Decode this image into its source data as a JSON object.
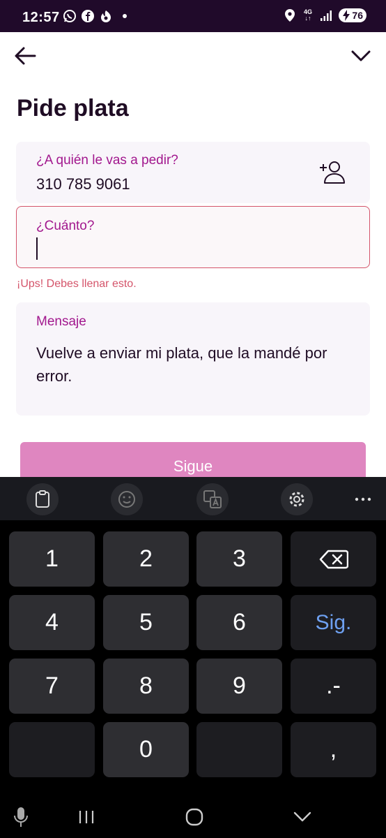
{
  "status_bar": {
    "time": "12:57",
    "network_type": "4G",
    "battery_level": "76",
    "left_icons": [
      "whatsapp-icon",
      "facebook-icon",
      "notification-app-icon"
    ],
    "right_icons": [
      "location-icon",
      "network-icon",
      "signal-icon",
      "battery-icon"
    ]
  },
  "header": {
    "back_icon": "arrow-left-icon",
    "collapse_icon": "chevron-down-icon",
    "title": "Pide plata"
  },
  "form": {
    "recipient": {
      "label": "¿A quién le vas a pedir?",
      "value": "310 785 9061",
      "action_icon": "add-contact-icon"
    },
    "amount": {
      "label": "¿Cuánto?",
      "value": "",
      "error": "¡Ups! Debes llenar esto."
    },
    "message": {
      "label": "Mensaje",
      "value": "Vuelve a enviar mi plata, que la mandé por error."
    },
    "submit_label": "Sigue"
  },
  "keyboard": {
    "toolbar": [
      "clipboard-icon",
      "emoji-icon",
      "translate-icon",
      "settings-icon",
      "more-icon"
    ],
    "keys": [
      [
        "1",
        "2",
        "3",
        "⌫"
      ],
      [
        "4",
        "5",
        "6",
        "Sig."
      ],
      [
        "7",
        "8",
        "9",
        ".-"
      ],
      [
        "",
        "0",
        "",
        ","
      ]
    ]
  },
  "navigation": {
    "buttons": [
      "mic-icon",
      "recents-icon",
      "home-icon",
      "back-icon"
    ]
  },
  "colors": {
    "status_bar": "#200a2a",
    "accent_label": "#a2188e",
    "error": "#d4546a",
    "button": "#df86c0",
    "keyboard_accent": "#6ea0f0"
  }
}
